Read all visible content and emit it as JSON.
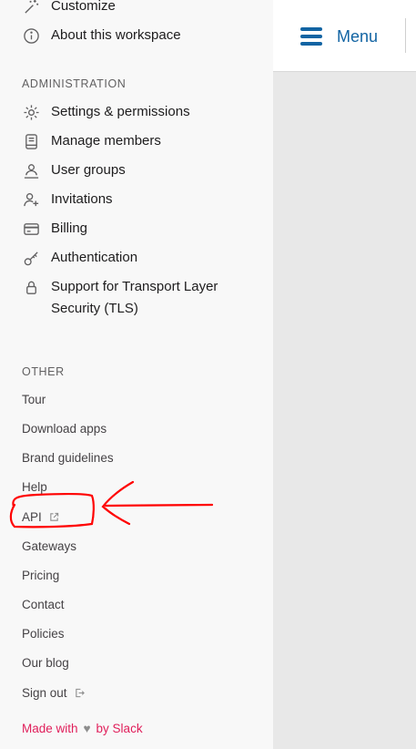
{
  "sidebar": {
    "top_items": [
      {
        "label": "Customize",
        "icon": "magic-wand-icon"
      },
      {
        "label": "About this workspace",
        "icon": "info-icon"
      }
    ],
    "administration": {
      "title": "ADMINISTRATION",
      "items": [
        {
          "label": "Settings & permissions",
          "icon": "gear-icon"
        },
        {
          "label": "Manage members",
          "icon": "member-directory-icon"
        },
        {
          "label": "User groups",
          "icon": "user-groups-icon"
        },
        {
          "label": "Invitations",
          "icon": "add-user-icon"
        },
        {
          "label": "Billing",
          "icon": "credit-card-icon"
        },
        {
          "label": "Authentication",
          "icon": "key-icon"
        },
        {
          "label": "Support for Transport Layer Security (TLS)",
          "label_line1": "Support for Transport Layer",
          "label_line2": "Security (TLS)",
          "icon": "lock-icon"
        }
      ]
    },
    "other": {
      "title": "OTHER",
      "links": [
        "Tour",
        "Download apps",
        "Brand guidelines",
        "Help",
        "API",
        "Gateways",
        "Pricing",
        "Contact",
        "Policies",
        "Our blog",
        "Sign out"
      ]
    },
    "footer": {
      "made_with": "Made with",
      "by": "by Slack"
    }
  },
  "header": {
    "menu_label": "Menu"
  },
  "colors": {
    "accent": "#1264a3",
    "footer": "#e01e5a",
    "annotation": "#ff0000"
  }
}
